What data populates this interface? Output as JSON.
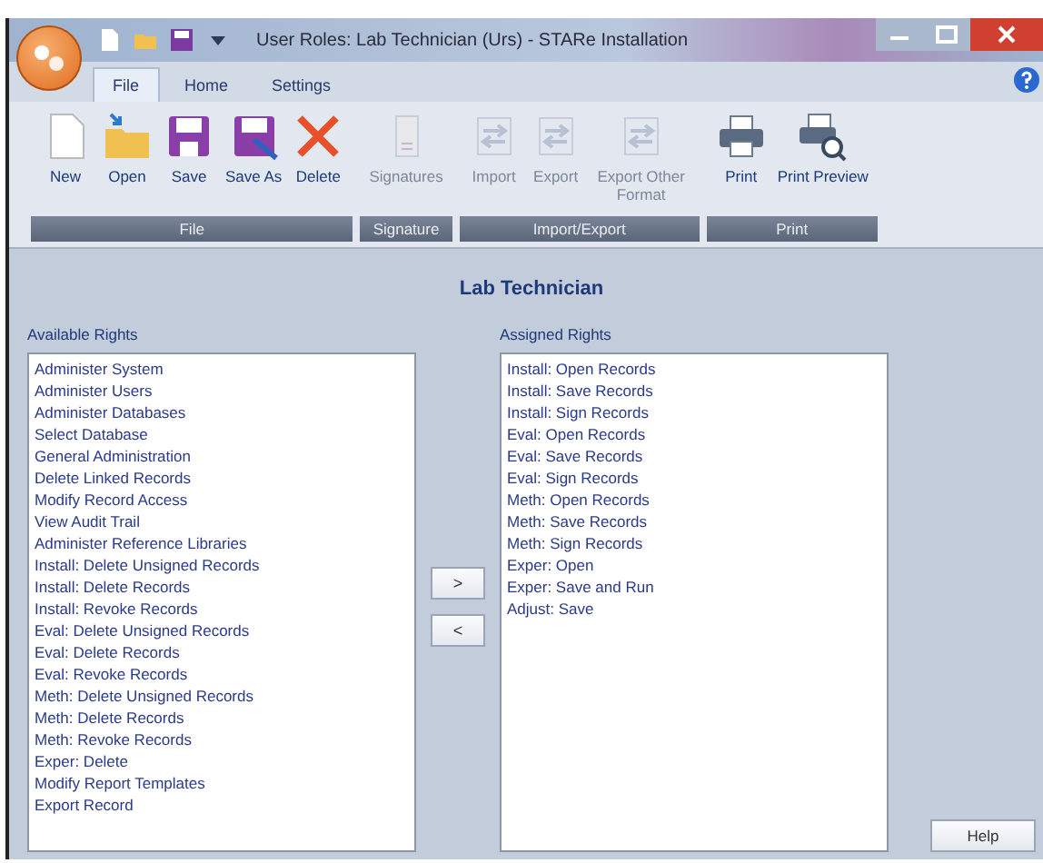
{
  "window": {
    "title": "User Roles: Lab Technician (Urs) - STARe Installation"
  },
  "tabs": [
    {
      "label": "File",
      "selected": true
    },
    {
      "label": "Home",
      "selected": false
    },
    {
      "label": "Settings",
      "selected": false
    }
  ],
  "ribbon": {
    "groups": [
      {
        "label": "File",
        "buttons": [
          {
            "kind": "new",
            "label": "New",
            "disabled": false
          },
          {
            "kind": "open",
            "label": "Open",
            "disabled": false
          },
          {
            "kind": "save",
            "label": "Save",
            "disabled": false
          },
          {
            "kind": "saveas",
            "label": "Save As",
            "disabled": false
          },
          {
            "kind": "delete",
            "label": "Delete",
            "disabled": false
          }
        ]
      },
      {
        "label": "Signature",
        "buttons": [
          {
            "kind": "signatures",
            "label": "Signatures",
            "disabled": true
          }
        ]
      },
      {
        "label": "Import/Export",
        "buttons": [
          {
            "kind": "import",
            "label": "Import",
            "disabled": true
          },
          {
            "kind": "export",
            "label": "Export",
            "disabled": true
          },
          {
            "kind": "exportother",
            "label": "Export Other Format",
            "disabled": true
          }
        ]
      },
      {
        "label": "Print",
        "buttons": [
          {
            "kind": "print",
            "label": "Print",
            "disabled": false
          },
          {
            "kind": "preview",
            "label": "Print Preview",
            "disabled": false
          }
        ]
      }
    ]
  },
  "heading": "Lab Technician",
  "available": {
    "label": "Available Rights",
    "items": [
      "Administer System",
      "Administer Users",
      "Administer Databases",
      "Select Database",
      "General Administration",
      "Delete Linked Records",
      "Modify Record Access",
      "View Audit Trail",
      "Administer Reference Libraries",
      "Install: Delete Unsigned Records",
      "Install: Delete Records",
      "Install: Revoke Records",
      "Eval: Delete Unsigned Records",
      "Eval: Delete Records",
      "Eval: Revoke Records",
      "Meth: Delete Unsigned Records",
      "Meth: Delete Records",
      "Meth: Revoke Records",
      "Exper: Delete",
      "Modify Report Templates",
      "Export Record"
    ]
  },
  "move_buttons": [
    ">",
    "<"
  ],
  "assigned": {
    "label": "Assigned Rights",
    "items": [
      "Install: Open Records",
      "Install: Save Records",
      "Install: Sign Records",
      "Eval: Open Records",
      "Eval: Save Records",
      "Eval: Sign Records",
      "Meth: Open Records",
      "Meth: Save Records",
      "Meth: Sign Records",
      "Exper: Open",
      "Exper: Save and Run",
      "Adjust: Save"
    ]
  },
  "help_button": "Help"
}
